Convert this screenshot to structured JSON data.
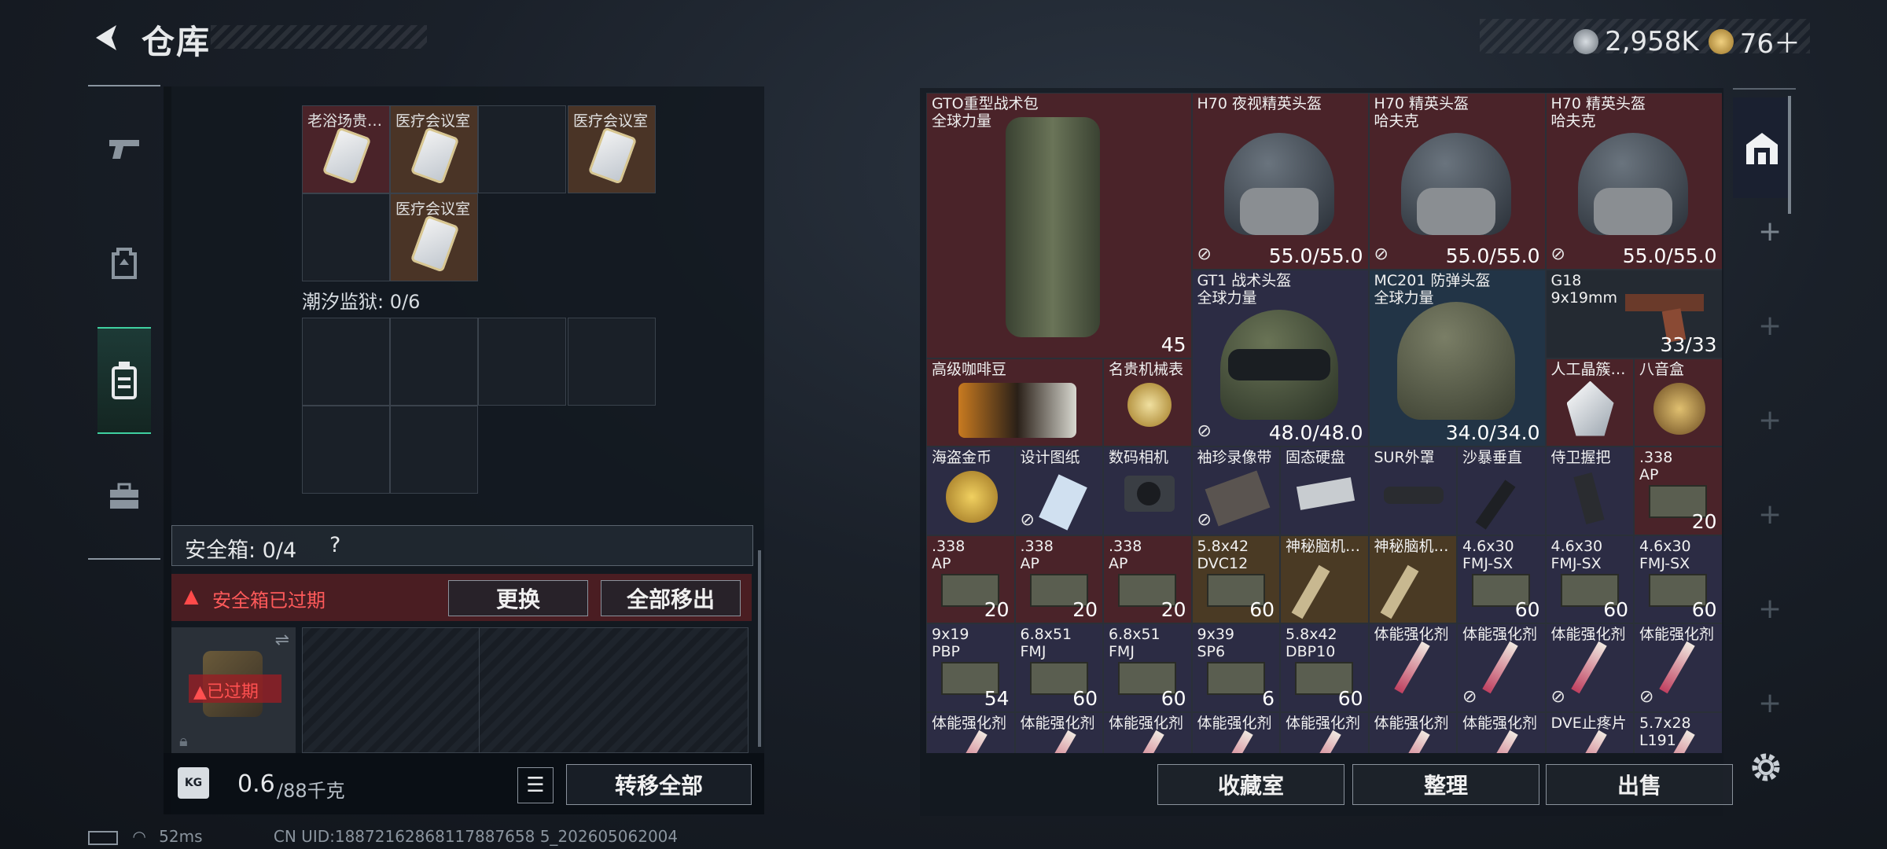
{
  "header": {
    "title": "仓库",
    "currency_silver": "2,958K",
    "currency_gold": "76＋"
  },
  "left": {
    "top_cells": [
      {
        "label": "老浴场贵…",
        "color": "red"
      },
      {
        "label": "医疗会议室",
        "color": "orange"
      },
      {
        "label": "医疗会议室",
        "color": "orange"
      },
      {
        "label": "医疗会议室",
        "color": "orange"
      }
    ],
    "prison_title": "潮汐监狱: 0/6",
    "safebox_title": "安全箱: 0/4",
    "help": "?",
    "expired_text": "安全箱已过期",
    "replace_btn": "更换",
    "move_all_btn": "全部移出",
    "expired_badge": "已过期",
    "weight": "0.6",
    "weight_max": "/88千克",
    "weight_icon": "KG",
    "transfer_all_btn": "转移全部"
  },
  "items": [
    {
      "name": "GTO重型战术包\n全球力量",
      "count": "45",
      "color": "red"
    },
    {
      "name": "H70 夜视精英头盔",
      "count": "55.0/55.0",
      "color": "red"
    },
    {
      "name": "H70 精英头盔\n哈夫克",
      "count": "55.0/55.0",
      "color": "red"
    },
    {
      "name": "H70 精英头盔\n哈夫克",
      "count": "55.0/55.0",
      "color": "red"
    },
    {
      "name": "GT1 战术头盔\n全球力量",
      "count": "48.0/48.0",
      "color": "purple"
    },
    {
      "name": "MC201 防弹头盔\n全球力量",
      "count": "34.0/34.0",
      "color": "blue"
    },
    {
      "name": "G18\n9x19mm",
      "count": "33/33",
      "color": "dark"
    },
    {
      "name": "高级咖啡豆",
      "count": "",
      "color": "red"
    },
    {
      "name": "名贵机械表",
      "count": "",
      "color": "red"
    },
    {
      "name": "人工晶簇…",
      "count": "",
      "color": "red"
    },
    {
      "name": "八音盒",
      "count": "",
      "color": "red"
    },
    {
      "name": "海盗金币",
      "count": "",
      "color": "purple"
    },
    {
      "name": "设计图纸",
      "count": "",
      "color": "purple"
    },
    {
      "name": "数码相机",
      "count": "",
      "color": "purple"
    },
    {
      "name": "袖珍录像带",
      "count": "",
      "color": "purple"
    },
    {
      "name": "固态硬盘",
      "count": "",
      "color": "purple"
    },
    {
      "name": "SUR外罩",
      "count": "",
      "color": "purple"
    },
    {
      "name": "沙暴垂直",
      "count": "",
      "color": "purple"
    },
    {
      "name": "侍卫握把",
      "count": "",
      "color": "purple"
    },
    {
      "name": ".338\nAP",
      "count": "20",
      "color": "red"
    },
    {
      "name": ".338\nAP",
      "count": "20",
      "color": "red"
    },
    {
      "name": ".338\nAP",
      "count": "20",
      "color": "red"
    },
    {
      "name": ".338\nAP",
      "count": "20",
      "color": "red"
    },
    {
      "name": "5.8x42\nDVC12",
      "count": "60",
      "color": "gold"
    },
    {
      "name": "神秘脑机…",
      "count": "",
      "color": "gold"
    },
    {
      "name": "神秘脑机…",
      "count": "",
      "color": "gold"
    },
    {
      "name": "4.6x30\nFMJ-SX",
      "count": "60",
      "color": "purple"
    },
    {
      "name": "4.6x30\nFMJ-SX",
      "count": "60",
      "color": "purple"
    },
    {
      "name": "4.6x30\nFMJ-SX",
      "count": "60",
      "color": "purple"
    },
    {
      "name": "9x19\nPBP",
      "count": "54",
      "color": "purple"
    },
    {
      "name": "6.8x51\nFMJ",
      "count": "60",
      "color": "purple"
    },
    {
      "name": "6.8x51\nFMJ",
      "count": "60",
      "color": "purple"
    },
    {
      "name": "9x39\nSP6",
      "count": "6",
      "color": "purple"
    },
    {
      "name": "5.8x42\nDBP10",
      "count": "60",
      "color": "purple"
    },
    {
      "name": "体能强化剂",
      "count": "",
      "color": "purple"
    },
    {
      "name": "体能强化剂",
      "count": "",
      "color": "purple"
    },
    {
      "name": "体能强化剂",
      "count": "",
      "color": "purple"
    },
    {
      "name": "体能强化剂",
      "count": "",
      "color": "purple"
    },
    {
      "name": "体能强化剂",
      "count": "",
      "color": "purple"
    },
    {
      "name": "体能强化剂",
      "count": "",
      "color": "purple"
    },
    {
      "name": "体能强化剂",
      "count": "",
      "color": "purple"
    },
    {
      "name": "体能强化剂",
      "count": "",
      "color": "purple"
    },
    {
      "name": "体能强化剂",
      "count": "",
      "color": "purple"
    },
    {
      "name": "体能强化剂",
      "count": "",
      "color": "purple"
    },
    {
      "name": "体能强化剂",
      "count": "",
      "color": "purple"
    },
    {
      "name": "DVE止疼片",
      "count": "",
      "color": "purple"
    },
    {
      "name": "5.7x28\nL191",
      "count": "",
      "color": "purple"
    }
  ],
  "bottom_buttons": {
    "collection": "收藏室",
    "sort": "整理",
    "sell": "出售"
  },
  "status": {
    "ping": "52ms",
    "uid": "CN UID:18872162868117887658 5_202605062004"
  },
  "icons": [
    "back-arrow-icon",
    "pistol-icon",
    "backpack-icon",
    "case-icon",
    "toolbox-icon",
    "warehouse-icon",
    "plus-icon",
    "gear-icon",
    "list-icon",
    "warning-icon",
    "lock-icon",
    "swap-icon",
    "battery-icon",
    "wifi-icon",
    "broken-durability-icon"
  ]
}
